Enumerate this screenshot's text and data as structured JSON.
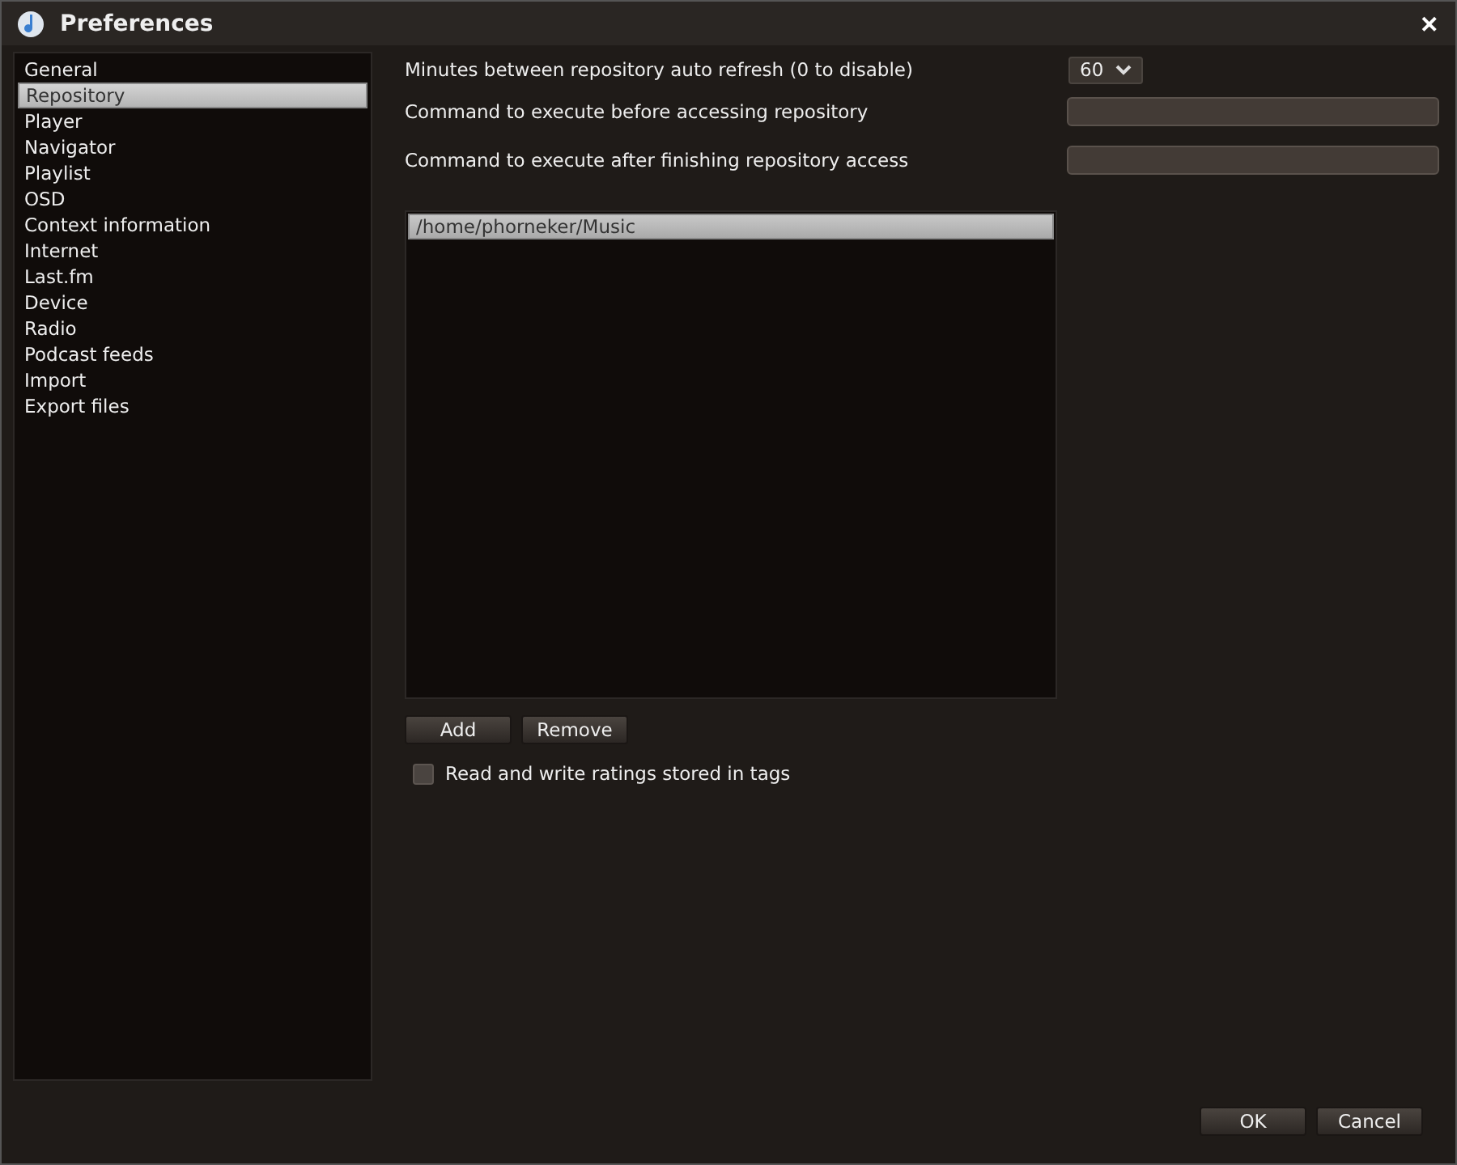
{
  "window": {
    "title": "Preferences",
    "close": "✕"
  },
  "sidebar": {
    "items": [
      {
        "label": "General",
        "selected": false
      },
      {
        "label": "Repository",
        "selected": true
      },
      {
        "label": "Player",
        "selected": false
      },
      {
        "label": "Navigator",
        "selected": false
      },
      {
        "label": "Playlist",
        "selected": false
      },
      {
        "label": "OSD",
        "selected": false
      },
      {
        "label": "Context information",
        "selected": false
      },
      {
        "label": "Internet",
        "selected": false
      },
      {
        "label": "Last.fm",
        "selected": false
      },
      {
        "label": "Device",
        "selected": false
      },
      {
        "label": "Radio",
        "selected": false
      },
      {
        "label": "Podcast feeds",
        "selected": false
      },
      {
        "label": "Import",
        "selected": false
      },
      {
        "label": "Export files",
        "selected": false
      }
    ]
  },
  "settings": [
    {
      "kind": "dropdown",
      "label": "Minutes between repository auto refresh (0 to disable)",
      "value": "60"
    },
    {
      "kind": "text",
      "label": "Command to execute before accessing repository"
    },
    {
      "kind": "text",
      "label": "Command to execute after finishing repository access"
    }
  ],
  "folders": {
    "items": [
      {
        "label": "/home/phorneker/Music",
        "selected": true
      }
    ],
    "buttons": [
      "Add",
      "Remove"
    ]
  },
  "ratings_checkbox": {
    "label": "Read and write ratings stored in tags",
    "checked": false
  },
  "buttons": [
    "OK",
    "Cancel"
  ]
}
